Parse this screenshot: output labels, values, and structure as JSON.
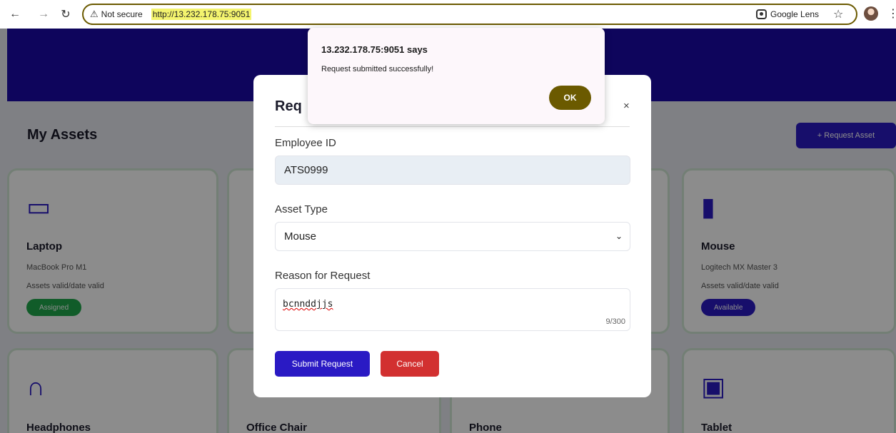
{
  "browser": {
    "security_label": "Not secure",
    "url": "http://13.232.178.75:9051",
    "lens_label": "Google Lens",
    "icons": [
      "back-icon",
      "forward-icon",
      "reload-icon",
      "warning-icon",
      "lens-icon",
      "star-icon",
      "avatar",
      "menu-icon"
    ]
  },
  "page": {
    "title": "My Assets",
    "request_button": "+ Request Asset",
    "cards": [
      {
        "icon": "laptop-icon",
        "name": "Laptop",
        "desc": "MacBook Pro M1",
        "date": "Assets valid/date valid",
        "badge": "Assigned",
        "badge_color": "#1fa84b"
      },
      {
        "icon": "mouse-icon",
        "name": "Mouse",
        "desc": "Logitech MX Master 3",
        "date": "Assets valid/date valid",
        "badge": "Available",
        "badge_color": "#2a1ac4"
      },
      {
        "icon": "headphones-icon",
        "name": "Headphones",
        "desc": "",
        "date": "",
        "badge": "",
        "badge_color": "#1fa84b"
      },
      {
        "icon": "chair-icon",
        "name": "Office Chair",
        "desc": "",
        "date": "",
        "badge": "",
        "badge_color": "#1fa84b"
      },
      {
        "icon": "phone-icon",
        "name": "Phone",
        "desc": "",
        "date": "",
        "badge": "",
        "badge_color": "#1fa84b"
      },
      {
        "icon": "tablet-icon",
        "name": "Tablet",
        "desc": "",
        "date": "",
        "badge": "",
        "badge_color": "#1fa84b"
      }
    ]
  },
  "modal": {
    "title": "Req",
    "close": "×",
    "employee_id_label": "Employee ID",
    "employee_id_value": "ATS0999",
    "asset_type_label": "Asset Type",
    "asset_type_value": "Mouse",
    "reason_label": "Reason for Request",
    "reason_value": "bcnnddjjs",
    "reason_count": "9/300",
    "submit_label": "Submit Request",
    "cancel_label": "Cancel"
  },
  "alert": {
    "title": "13.232.178.75:9051 says",
    "message": "Request submitted successfully!",
    "ok_label": "OK"
  },
  "colors": {
    "brand": "#2a1ac4",
    "banner": "#1a0aa8",
    "cancel": "#d23030",
    "alert_button": "#6b5a00"
  }
}
